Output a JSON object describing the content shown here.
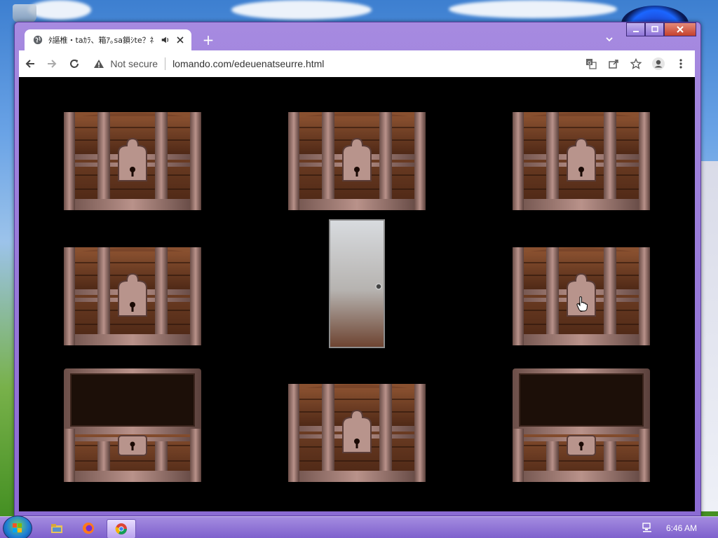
{
  "browser": {
    "tab": {
      "title": "ﾀ謳椎・taｶﾗ、箱ｱ｡sa鎖ｼte？ﾈ",
      "audio_icon": "speaker-icon",
      "close_icon": "close-icon"
    },
    "new_tab_label": "+",
    "omnibox": {
      "security_label": "Not secure",
      "url": "lomando.com/edeuenatseurre.html"
    },
    "toolbar_icons": [
      "translate-icon",
      "share-icon",
      "star-icon",
      "profile-icon",
      "menu-icon"
    ]
  },
  "window_controls": [
    "minimize",
    "maximize",
    "close"
  ],
  "game": {
    "chests": [
      {
        "state": "closed"
      },
      {
        "state": "closed"
      },
      {
        "state": "closed"
      },
      {
        "state": "closed"
      },
      {
        "state": "closed"
      },
      {
        "state": "open"
      },
      {
        "state": "closed"
      },
      {
        "state": "open"
      }
    ],
    "door": {
      "state": "closed"
    }
  },
  "taskbar": {
    "apps": [
      "file-explorer-icon",
      "firefox-icon",
      "chrome-icon"
    ],
    "clock": "6:46 AM"
  }
}
